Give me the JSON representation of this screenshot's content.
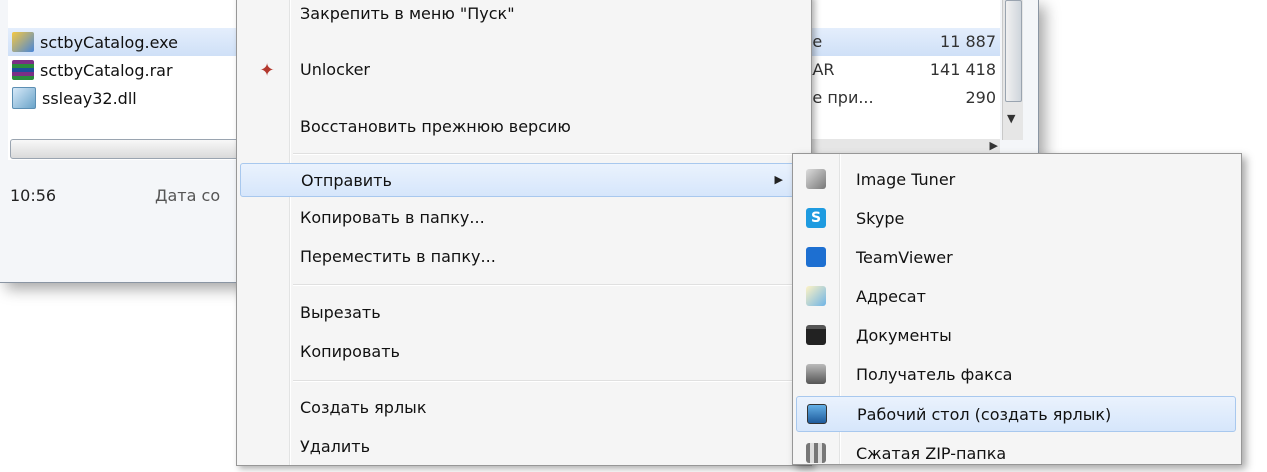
{
  "explorer": {
    "files": [
      {
        "name": "sctbyCatalog.exe",
        "icon": "exe-icon",
        "selected": true
      },
      {
        "name": "sctbyCatalog.rar",
        "icon": "winrar-icon",
        "selected": false
      },
      {
        "name": "ssleay32.dll",
        "icon": "dll-icon",
        "selected": false
      }
    ],
    "details": [
      {
        "type": "ие",
        "size": "11 887",
        "selected": true
      },
      {
        "type": "RAR",
        "size": "141 418",
        "selected": false
      },
      {
        "type": "ие при...",
        "size": "290",
        "selected": false
      }
    ],
    "status": {
      "time": "10:56",
      "label": "Дата со"
    }
  },
  "context_menu": {
    "items": [
      {
        "label": "Закрепить в меню \"Пуск\""
      },
      {
        "label": "Unlocker",
        "icon": "wand-icon"
      },
      {
        "label": "Восстановить прежнюю версию"
      },
      {
        "label": "Отправить",
        "has_submenu": true,
        "highlighted": true
      },
      {
        "label": "Копировать в папку..."
      },
      {
        "label": "Переместить в папку..."
      },
      {
        "label": "Вырезать"
      },
      {
        "label": "Копировать"
      },
      {
        "label": "Создать ярлык"
      },
      {
        "label": "Удалить"
      }
    ]
  },
  "send_to_menu": {
    "items": [
      {
        "label": "Image Tuner",
        "icon": "image-tuner-icon"
      },
      {
        "label": "Skype",
        "icon": "skype-icon"
      },
      {
        "label": "TeamViewer",
        "icon": "teamviewer-icon"
      },
      {
        "label": "Адресат",
        "icon": "mail-recipient-icon"
      },
      {
        "label": "Документы",
        "icon": "documents-icon"
      },
      {
        "label": "Получатель факса",
        "icon": "fax-icon"
      },
      {
        "label": "Рабочий стол (создать ярлык)",
        "icon": "desktop-icon",
        "highlighted": true
      },
      {
        "label": "Сжатая ZIP-папка",
        "icon": "zip-folder-icon"
      }
    ]
  },
  "colors": {
    "highlight_top": "#eaf2fd",
    "highlight_bottom": "#d6e6fb",
    "highlight_border": "#a8c8ee",
    "menu_bg": "#f5f5f5"
  }
}
